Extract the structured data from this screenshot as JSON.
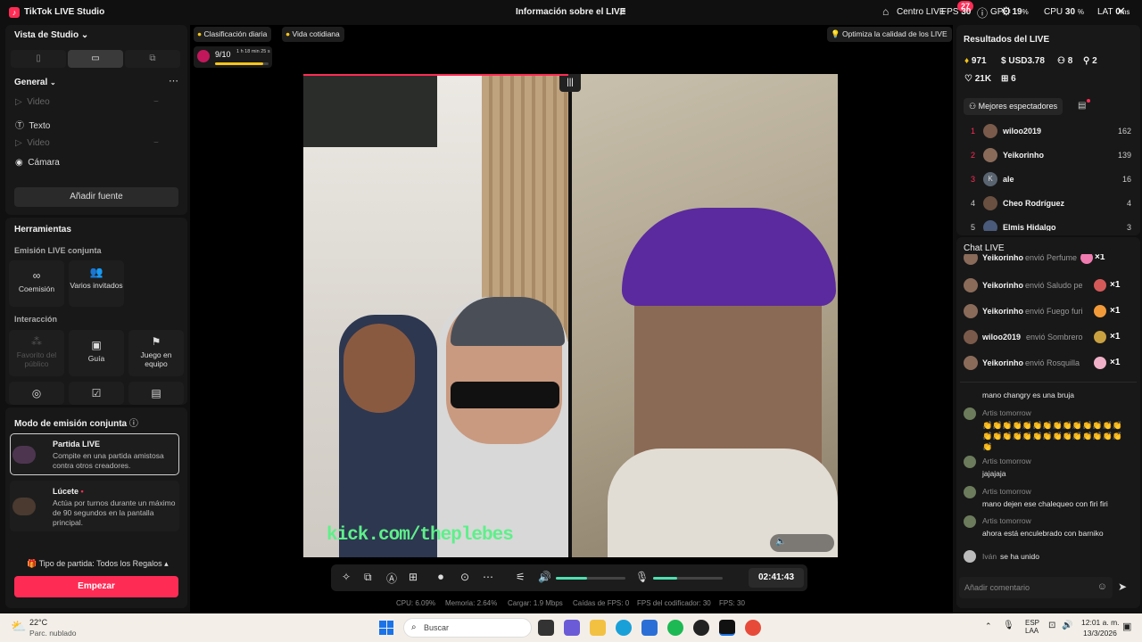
{
  "titlebar": {
    "app_name": "TikTok LIVE Studio",
    "center_title": "Información sobre el LIVE",
    "live_center": "Centro LIVE",
    "notif_count": "27",
    "fps_label": "FPS",
    "fps_value": "30",
    "gpu_label": "GPU",
    "gpu_value": "19",
    "gpu_unit": "%",
    "cpu_label": "CPU",
    "cpu_value": "30",
    "cpu_unit": "%",
    "lat_label": "LAT",
    "lat_value": "0",
    "lat_unit": "ms"
  },
  "left": {
    "studio_view": "Vista de Studio",
    "orientation_options": [
      "portrait",
      "landscape",
      "dual"
    ],
    "orientation_selected": "landscape",
    "general": "General",
    "sources": [
      {
        "name": "Video",
        "dim": true
      },
      {
        "name": "Texto",
        "dim": false
      },
      {
        "name": "Video",
        "dim": true
      },
      {
        "name": "Cámara",
        "dim": false
      }
    ],
    "add_source": "Añadir fuente",
    "tools_title": "Herramientas",
    "co_live_title": "Emisión LIVE conjunta",
    "co_live_tools": [
      "Coemisión",
      "Varios invitados"
    ],
    "interaction_title": "Interacción",
    "interaction_tools": [
      "Favorito del público",
      "Guía",
      "Juego en equipo"
    ],
    "mode_title": "Modo de emisión conjunta",
    "modes": [
      {
        "title": "Partida LIVE",
        "desc": "Compite en una partida amistosa contra otros creadores.",
        "selected": true
      },
      {
        "title": "Lúcete",
        "desc": "Actúa por turnos durante un máximo de 90 segundos en la pantalla principal.",
        "selected": false
      }
    ],
    "match_type": "Tipo de partida: Todos los Regalos",
    "start_button": "Empezar"
  },
  "center": {
    "pills": [
      "Clasificación diaria",
      "Vida cotidiana"
    ],
    "optimize": "Optimiza la calidad de los LIVE",
    "rank_progress": "9/10",
    "rank_time": "1 h 18 min 25 s",
    "rank_fraction": 0.9,
    "overlay_text": "kick.com/theplebes",
    "timer": "02:41:43",
    "speaker_level": 0.45,
    "mic_level": 0.35,
    "stats": {
      "cpu": "CPU:  6.09%",
      "memory": "Memoria:  2.64%",
      "upload": "Cargar:  1.9 Mbps",
      "fps_drops": "Caídas de FPS:  0",
      "encoder_fps": "FPS del codificador:  30",
      "fps": "FPS:  30"
    }
  },
  "right": {
    "results_title": "Resultados del LIVE",
    "diamonds": "971",
    "usd": "USD3.78",
    "viewers": "8",
    "new_followers": "2",
    "likes": "21K",
    "gifts": "6",
    "top_viewers_btn": "Mejores espectadores",
    "top_viewers": [
      {
        "rank": "1",
        "name": "wiloo2019",
        "score": "162",
        "color": "#7a5a4a"
      },
      {
        "rank": "2",
        "name": "Yeikorinho",
        "score": "139",
        "color": "#8a6b5a"
      },
      {
        "rank": "3",
        "name": "ale",
        "score": "16",
        "color": "#5a6470"
      },
      {
        "rank": "4",
        "name": "Cheo Rodríguez",
        "score": "4",
        "color": "#6a5040"
      },
      {
        "rank": "5",
        "name": "Elmis Hidalgo",
        "score": "3",
        "color": "#4a5a7a"
      }
    ],
    "chat_title": "Chat LIVE",
    "gift_events": [
      {
        "name": "Yeikorinho",
        "text": "envió Perfume",
        "count": "×1",
        "gift_color": "#f07bb0"
      },
      {
        "name": "Yeikorinho",
        "text": "envió Saludo perso",
        "count": "×1",
        "gift_color": "#d45a5a"
      },
      {
        "name": "Yeikorinho",
        "text": "envió Fuego furios",
        "count": "×1",
        "gift_color": "#f29a3a"
      },
      {
        "name": "wiloo2019",
        "text": "envió Sombrero y",
        "count": "×1",
        "gift_color": "#c8a040"
      },
      {
        "name": "Yeikorinho",
        "text": "envió Rosquilla",
        "count": "×1",
        "gift_color": "#f0b0c8"
      }
    ],
    "messages": [
      {
        "name": "",
        "text": "mano changry es una bruja"
      },
      {
        "name": "Artis tomorrow",
        "text": "👏👏👏👏👏👏👏👏👏👏👏👏👏👏👏👏👏👏👏👏👏👏👏👏👏👏👏👏👏"
      },
      {
        "name": "Artis tomorrow",
        "text": "jajajaja"
      },
      {
        "name": "Artis tomorrow",
        "text": "mano dejen ese chalequeo con firi firi"
      },
      {
        "name": "Artis tomorrow",
        "text": "ahora está enculebrado con barniko"
      }
    ],
    "join_name": "Iván",
    "join_text": "se ha unido",
    "comment_placeholder": "Añadir comentario"
  },
  "taskbar": {
    "temp": "22°C",
    "weather": "Parc. nublado",
    "search": "Buscar",
    "lang": "ESP",
    "lang2": "LAA",
    "time": "12:01 a. m.",
    "date": "13/3/2026"
  }
}
